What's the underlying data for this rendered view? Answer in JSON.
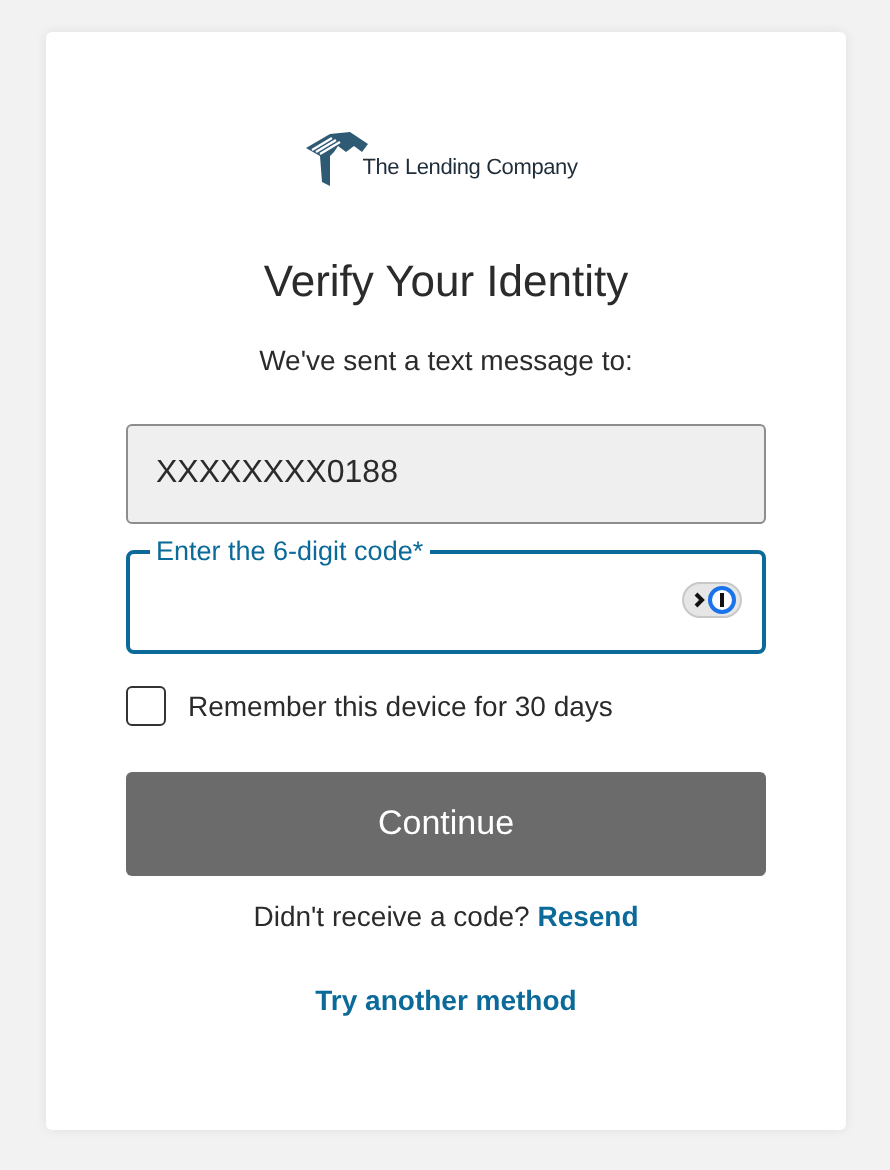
{
  "logo": {
    "name": "The Lending Company"
  },
  "title": "Verify Your Identity",
  "message": "We've sent a text message to:",
  "phone_field": {
    "value": "XXXXXXXX0188"
  },
  "code_field": {
    "label": "Enter the 6-digit code*",
    "focused": true
  },
  "remember": {
    "label": "Remember this device for 30 days",
    "checked": false
  },
  "continue_button": {
    "label": "Continue"
  },
  "resend": {
    "text": "Didn't receive a code?",
    "link": "Resend"
  },
  "other_method": {
    "link": "Try another method"
  }
}
